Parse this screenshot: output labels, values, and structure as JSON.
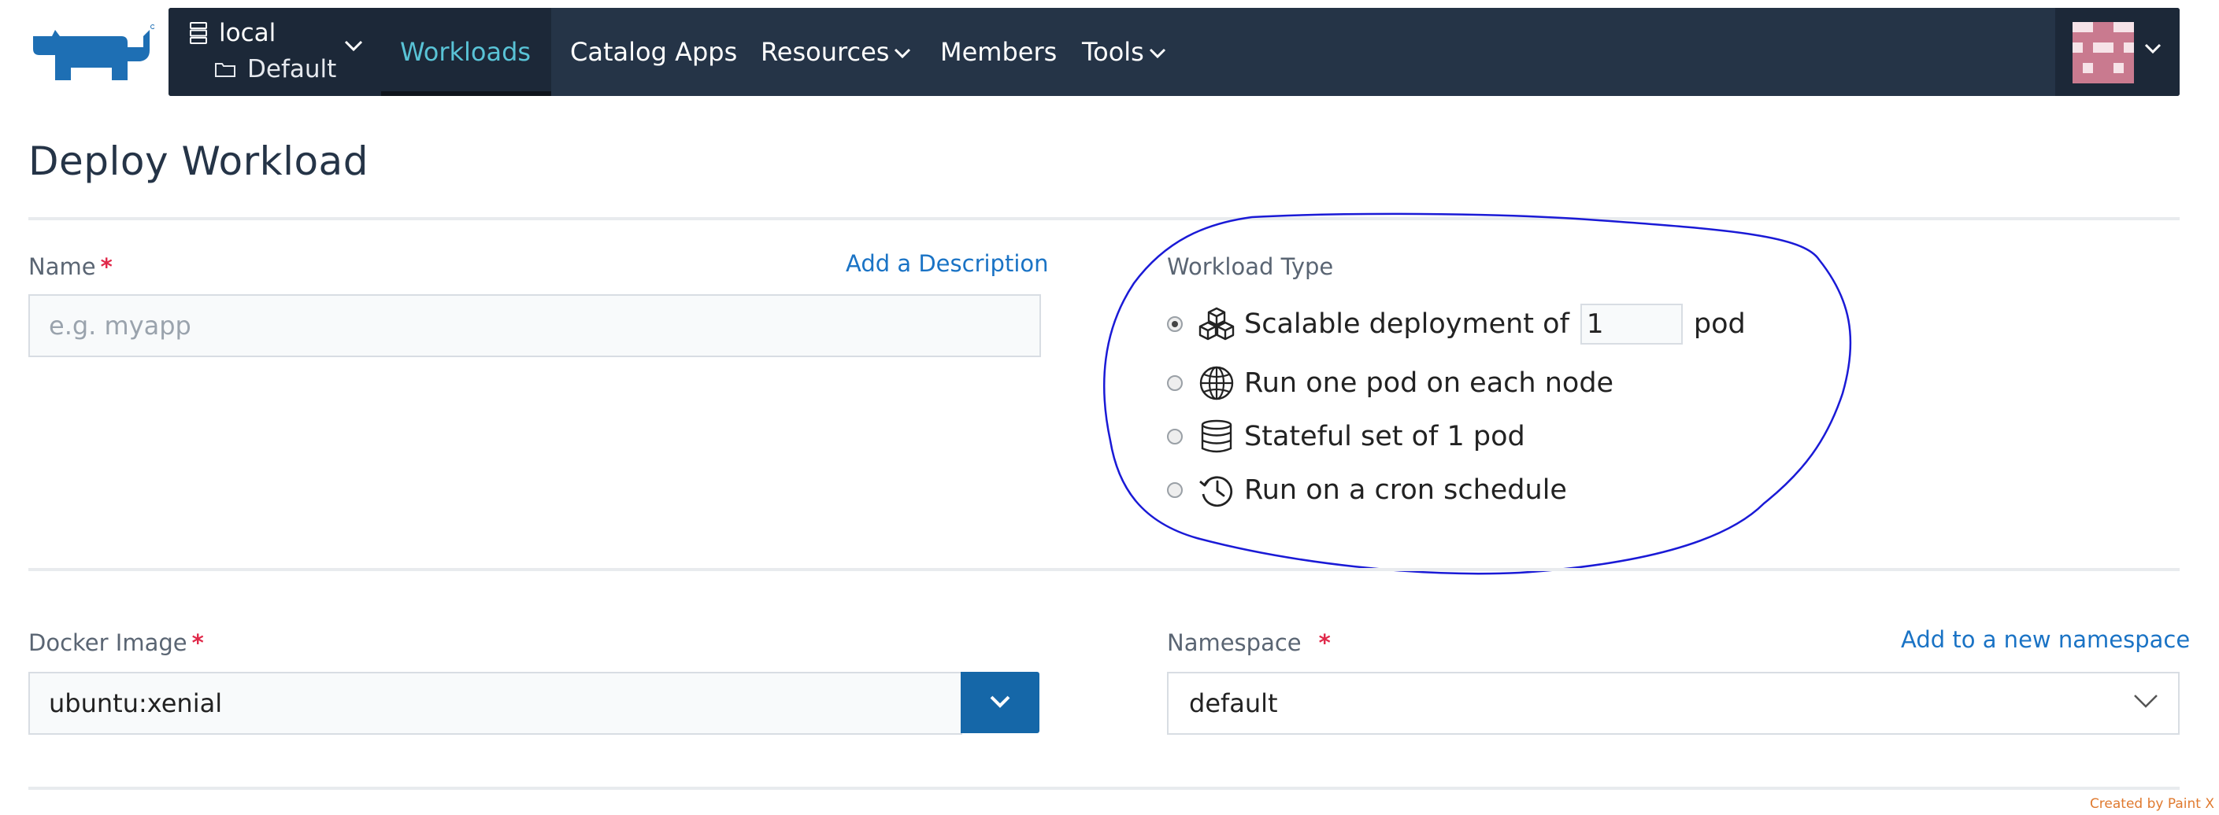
{
  "header": {
    "logo_alt": "Rancher logo",
    "context": {
      "cluster": "local",
      "project": "Default"
    },
    "nav": [
      {
        "label": "Workloads",
        "active": true
      },
      {
        "label": "Catalog Apps",
        "active": false
      },
      {
        "label": "Resources",
        "active": false,
        "dropdown": true
      },
      {
        "label": "Members",
        "active": false
      },
      {
        "label": "Tools",
        "active": false,
        "dropdown": true
      }
    ]
  },
  "page": {
    "title": "Deploy Workload"
  },
  "form": {
    "name": {
      "label": "Name",
      "required_mark": "*",
      "placeholder": "e.g. myapp",
      "value": "",
      "add_description_link": "Add a Description"
    },
    "workload_type": {
      "label": "Workload Type",
      "options": [
        {
          "pre": "Scalable deployment of",
          "count": "1",
          "post": "pod",
          "selected": true,
          "icon": "cubes-icon"
        },
        {
          "text": "Run one pod on each node",
          "selected": false,
          "icon": "globe-icon"
        },
        {
          "text": "Stateful set of 1 pod",
          "selected": false,
          "icon": "database-icon"
        },
        {
          "text": "Run on a cron schedule",
          "selected": false,
          "icon": "history-icon"
        }
      ]
    },
    "docker_image": {
      "label": "Docker Image",
      "required_mark": "*",
      "value": "ubuntu:xenial"
    },
    "namespace": {
      "label": "Namespace",
      "required_mark": "*",
      "value": "default",
      "new_namespace_link": "Add to a new namespace"
    }
  },
  "watermark": "Created by Paint X",
  "colors": {
    "nav_bg": "#253447",
    "nav_active": "#59c3d6",
    "primary": "#1567a8",
    "link": "#1a73c5",
    "required": "#e0294a",
    "annotation": "#1a1ad6"
  }
}
